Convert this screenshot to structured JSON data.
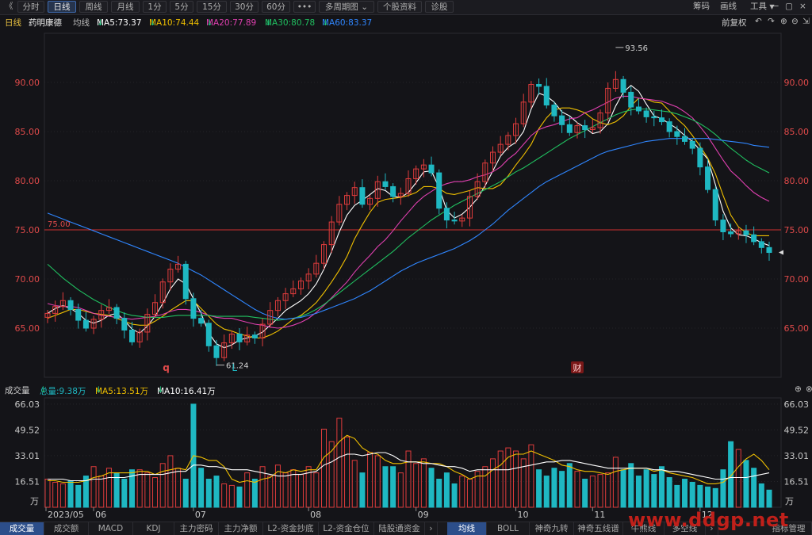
{
  "toolbar": {
    "back": "《",
    "tabs": [
      "分时",
      "日线",
      "周线",
      "月线",
      "1分",
      "5分",
      "15分",
      "30分",
      "60分",
      "•••",
      "多周期图",
      "个股资料",
      "诊股"
    ],
    "active_tab": "日线",
    "dropdown_arrow": "⌄",
    "right": [
      "筹码",
      "画线",
      "工具"
    ],
    "window_controls": [
      "−",
      "▢",
      "×"
    ]
  },
  "info": {
    "period": "日线",
    "name": "药明康德",
    "avg_label": "均线",
    "ma5": "MA5:73.37",
    "ma10": "MA10:74.44",
    "ma20": "MA20:77.89",
    "ma30": "MA30:80.78",
    "ma60": "MA60:83.37",
    "fuquan": "前复权",
    "colors": {
      "ma5": "#ffffff",
      "ma10": "#f0c000",
      "ma20": "#e040b0",
      "ma30": "#20c060",
      "ma60": "#2f86ff",
      "up": "#e03c3c",
      "down": "#1fb8c2"
    }
  },
  "volume_header": {
    "title": "成交量",
    "total": "总量:9.38万",
    "ma5": "MA5:13.51万",
    "ma10": "MA10:16.41万"
  },
  "chart_data": {
    "type": "candlestick",
    "price_ticks": [
      "90.00",
      "85.00",
      "80.00",
      "75.00",
      "70.00",
      "65.00"
    ],
    "price_tick_values": [
      90,
      85,
      80,
      75,
      70,
      65
    ],
    "ylim": [
      60,
      95
    ],
    "h_line_label": "75.00",
    "h_line_value": 75,
    "annotations": {
      "high": "93.56",
      "low": "61.24",
      "markers": [
        "q",
        "L",
        "财"
      ]
    },
    "month_labels": [
      "2023/05",
      "06",
      "07",
      "08",
      "09",
      "10",
      "11",
      "12"
    ],
    "volume_ticks": [
      "66.03",
      "49.52",
      "33.01",
      "16.51"
    ],
    "volume_tick_values": [
      66.03,
      49.52,
      33.01,
      16.51
    ],
    "volume_unit": "万",
    "volume_ylim": [
      0,
      70
    ],
    "series": [
      {
        "name": "MA5",
        "values": [
          66.5,
          67.0,
          67.3,
          67.0,
          66.5,
          65.8,
          65.5,
          65.8,
          66.3,
          66.5,
          65.8,
          64.9,
          64.5,
          65.2,
          66.2,
          67.5,
          69.0,
          70.0,
          69.5,
          68.0,
          66.5,
          64.5,
          63.4,
          63.0,
          63.3,
          63.8,
          64.0,
          64.2,
          64.6,
          65.3,
          66.0,
          66.8,
          67.3,
          67.8,
          68.5,
          69.5,
          71.0,
          72.8,
          74.8,
          76.5,
          77.5,
          78.0,
          78.6,
          79.2,
          79.0,
          78.4,
          78.3,
          78.8,
          79.8,
          80.9,
          81.0,
          79.3,
          77.0,
          76.2,
          76.6,
          77.3,
          78.2,
          79.5,
          81.0,
          82.5,
          83.4,
          83.9,
          85.0,
          87.3,
          88.9,
          88.6,
          88.0,
          87.0,
          86.6,
          85.9,
          85.4,
          84.8,
          85.0,
          85.8,
          87.6,
          89.0,
          89.7,
          89.1,
          87.8,
          86.6,
          86.3,
          85.8,
          85.3,
          84.6,
          84.0,
          83.1,
          82.2,
          79.6,
          76.9,
          75.2,
          74.5,
          74.4,
          74.1,
          73.7,
          73.4
        ]
      },
      {
        "name": "MA10",
        "values": [
          66.0,
          66.3,
          66.6,
          66.9,
          66.9,
          66.7,
          66.5,
          66.4,
          66.3,
          66.0,
          65.7,
          65.4,
          65.3,
          65.3,
          65.7,
          66.2,
          66.8,
          67.3,
          67.8,
          67.8,
          67.0,
          66.2,
          65.4,
          64.9,
          64.7,
          64.4,
          64.2,
          64.0,
          64.0,
          64.3,
          64.7,
          65.3,
          65.9,
          66.3,
          66.9,
          67.6,
          68.6,
          69.7,
          70.9,
          72.3,
          74.1,
          75.5,
          76.8,
          77.8,
          78.1,
          78.2,
          78.3,
          78.5,
          78.8,
          79.4,
          79.4,
          79.2,
          78.7,
          78.6,
          78.8,
          79.0,
          79.3,
          79.2,
          79.2,
          79.6,
          80.5,
          81.6,
          82.6,
          83.7,
          85.3,
          86.4,
          87.2,
          87.4,
          87.4,
          87.2,
          86.9,
          86.3,
          85.9,
          85.7,
          86.0,
          86.6,
          87.6,
          88.4,
          88.3,
          88.0,
          87.9,
          87.1,
          86.3,
          85.6,
          84.6,
          83.5,
          82.3,
          80.7,
          78.5,
          76.5,
          75.3,
          74.7,
          74.4,
          74.4,
          74.4
        ]
      },
      {
        "name": "MA20",
        "values": [
          67.5,
          67.3,
          67.2,
          67.2,
          67.1,
          66.8,
          66.5,
          66.3,
          66.2,
          66.1,
          66.0,
          65.9,
          66.0,
          66.1,
          66.2,
          66.4,
          66.7,
          66.9,
          66.9,
          66.8,
          66.6,
          66.3,
          66.1,
          66.0,
          66.0,
          65.8,
          65.6,
          65.4,
          65.3,
          65.1,
          65.0,
          65.1,
          65.3,
          65.6,
          66.0,
          66.6,
          67.3,
          68.1,
          68.9,
          69.7,
          70.7,
          71.6,
          72.4,
          73.3,
          74.0,
          74.9,
          75.9,
          76.8,
          77.7,
          78.4,
          78.9,
          79.4,
          79.7,
          79.9,
          79.9,
          80.1,
          80.4,
          80.6,
          80.9,
          81.4,
          82.2,
          82.8,
          83.7,
          84.6,
          85.2,
          85.5,
          85.7,
          86.0,
          86.3,
          86.4,
          86.9,
          87.2,
          87.6,
          88.0,
          88.4,
          88.6,
          88.6,
          88.4,
          88.3,
          88.2,
          88.1,
          87.8,
          87.5,
          87.0,
          86.4,
          85.5,
          84.5,
          83.3,
          82.1,
          81.0,
          80.3,
          79.5,
          78.8,
          78.3,
          77.9
        ]
      },
      {
        "name": "MA30",
        "values": [
          71.5,
          70.8,
          70.1,
          69.5,
          68.9,
          68.4,
          67.9,
          67.5,
          67.1,
          66.8,
          66.5,
          66.3,
          66.2,
          66.1,
          66.1,
          66.1,
          66.2,
          66.3,
          66.3,
          66.3,
          66.3,
          66.3,
          66.2,
          66.2,
          66.2,
          66.2,
          66.2,
          66.1,
          66.0,
          65.9,
          65.8,
          65.9,
          66.0,
          66.2,
          66.5,
          66.9,
          67.4,
          68.0,
          68.6,
          69.2,
          69.8,
          70.4,
          71.0,
          71.6,
          72.2,
          72.8,
          73.5,
          74.2,
          74.8,
          75.4,
          76.0,
          76.5,
          77.0,
          77.5,
          77.9,
          78.3,
          78.7,
          79.1,
          79.5,
          79.9,
          80.4,
          80.9,
          81.3,
          81.8,
          82.3,
          82.8,
          83.3,
          83.8,
          84.3,
          84.7,
          85.1,
          85.5,
          85.9,
          86.3,
          86.7,
          87.0,
          87.2,
          87.3,
          87.3,
          87.2,
          87.1,
          87.0,
          86.8,
          86.5,
          86.2,
          85.8,
          85.3,
          84.7,
          84.0,
          83.3,
          82.7,
          82.1,
          81.6,
          81.2,
          80.8
        ]
      },
      {
        "name": "MA60",
        "values": [
          76.7,
          76.4,
          76.1,
          75.8,
          75.5,
          75.2,
          74.9,
          74.6,
          74.3,
          74.0,
          73.7,
          73.4,
          73.1,
          72.8,
          72.5,
          72.2,
          71.9,
          71.6,
          71.2,
          70.8,
          70.4,
          69.9,
          69.4,
          68.9,
          68.4,
          67.9,
          67.4,
          66.9,
          66.5,
          66.2,
          66.0,
          65.9,
          66.0,
          66.1,
          66.3,
          66.5,
          66.8,
          67.1,
          67.4,
          67.7,
          68.0,
          68.4,
          68.8,
          69.3,
          69.8,
          70.3,
          70.8,
          71.2,
          71.6,
          71.9,
          72.2,
          72.5,
          72.8,
          73.1,
          73.5,
          73.9,
          74.4,
          75.0,
          75.6,
          76.3,
          77.0,
          77.6,
          78.2,
          78.8,
          79.4,
          79.9,
          80.3,
          80.7,
          81.1,
          81.5,
          81.9,
          82.3,
          82.7,
          83.0,
          83.2,
          83.4,
          83.6,
          83.8,
          84.0,
          84.1,
          84.2,
          84.3,
          84.3,
          84.3,
          84.3,
          84.3,
          84.3,
          84.2,
          84.1,
          84.0,
          83.9,
          83.8,
          83.6,
          83.5,
          83.4
        ]
      }
    ],
    "closes": [
      66.5,
      67.2,
      67.8,
      66.9,
      65.8,
      65.0,
      65.9,
      66.8,
      67.1,
      66.0,
      64.8,
      63.6,
      64.6,
      66.4,
      67.6,
      69.7,
      71.0,
      71.5,
      68.0,
      66.0,
      65.5,
      63.2,
      62.0,
      63.5,
      64.4,
      63.6,
      64.3,
      64.0,
      65.4,
      66.8,
      67.8,
      68.5,
      69.0,
      69.8,
      70.5,
      71.6,
      73.5,
      75.8,
      77.6,
      78.5,
      79.3,
      77.6,
      78.2,
      79.9,
      79.4,
      78.4,
      78.7,
      80.2,
      81.2,
      81.6,
      80.8,
      77.2,
      76.0,
      75.9,
      76.2,
      78.4,
      79.9,
      81.8,
      82.9,
      83.7,
      84.6,
      85.8,
      88.0,
      89.8,
      89.6,
      87.7,
      86.6,
      85.7,
      84.9,
      85.6,
      85.2,
      85.4,
      86.9,
      89.4,
      90.3,
      89.0,
      87.5,
      87.1,
      86.5,
      86.4,
      86.0,
      85.0,
      84.5,
      84.0,
      83.3,
      81.4,
      79.1,
      76.0,
      74.8,
      74.6,
      74.9,
      74.5,
      73.8,
      73.2,
      72.7
    ],
    "volumes": [
      18,
      16,
      15,
      17,
      14,
      20,
      26,
      20,
      25,
      22,
      18,
      24,
      24,
      22,
      19,
      28,
      33,
      25,
      18,
      66,
      25,
      18,
      20,
      15,
      14,
      13,
      22,
      18,
      26,
      20,
      27,
      22,
      24,
      21,
      26,
      22,
      50,
      42,
      57,
      45,
      30,
      22,
      35,
      33,
      26,
      26,
      22,
      36,
      28,
      31,
      25,
      18,
      22,
      15,
      20,
      18,
      23,
      26,
      31,
      36,
      38,
      36,
      31,
      40,
      24,
      20,
      25,
      23,
      28,
      23,
      18,
      20,
      21,
      22,
      32,
      24,
      28,
      20,
      24,
      21,
      26,
      19,
      14,
      18,
      16,
      14,
      13,
      12,
      24,
      42,
      37,
      30,
      25,
      15,
      11
    ],
    "volume_ma5": [
      17,
      17,
      16,
      16,
      16,
      17,
      19,
      20,
      22,
      22,
      22,
      22,
      23,
      23,
      21,
      23,
      24,
      25,
      24,
      33,
      32,
      30,
      30,
      26,
      18,
      16,
      17,
      16,
      18,
      19,
      23,
      22,
      24,
      23,
      24,
      24,
      32,
      36,
      42,
      46,
      44,
      38,
      35,
      34,
      30,
      28,
      28,
      29,
      29,
      29,
      28,
      28,
      26,
      23,
      21,
      18,
      20,
      20,
      24,
      27,
      32,
      34,
      34,
      36,
      34,
      32,
      30,
      27,
      26,
      24,
      23,
      23,
      22,
      21,
      23,
      24,
      25,
      25,
      25,
      23,
      24,
      22,
      21,
      20,
      19,
      17,
      15,
      15,
      16,
      20,
      26,
      31,
      34,
      30,
      24
    ],
    "volume_ma10": [
      18,
      18,
      18,
      17,
      17,
      17,
      18,
      18,
      19,
      19,
      19,
      20,
      21,
      21,
      21,
      21,
      22,
      23,
      23,
      27,
      27,
      26,
      26,
      25,
      24,
      24,
      24,
      23,
      22,
      21,
      20,
      20,
      21,
      21,
      22,
      23,
      27,
      29,
      32,
      34,
      34,
      33,
      34,
      35,
      35,
      33,
      30,
      29,
      29,
      28,
      28,
      27,
      26,
      26,
      25,
      23,
      24,
      24,
      24,
      24,
      24,
      25,
      26,
      27,
      28,
      29,
      29,
      30,
      30,
      29,
      28,
      27,
      26,
      25,
      25,
      25,
      25,
      25,
      25,
      24,
      24,
      23,
      23,
      22,
      21,
      20,
      19,
      18,
      18,
      19,
      19,
      19,
      20,
      21,
      22
    ]
  },
  "bottom_tabs": {
    "left": [
      "成交量",
      "成交额",
      "MACD",
      "KDJ",
      "主力密码",
      "主力净额",
      "L2-资金抄底",
      "L2-资金仓位",
      "陆股通资金"
    ],
    "right": [
      "均线",
      "BOLL",
      "神奇九转",
      "神奇五线谱",
      "牛熊线",
      "多空线",
      "指标管理"
    ],
    "arrow_left": "›",
    "arrow_right": "›"
  },
  "watermark": "www.ddgp.net"
}
